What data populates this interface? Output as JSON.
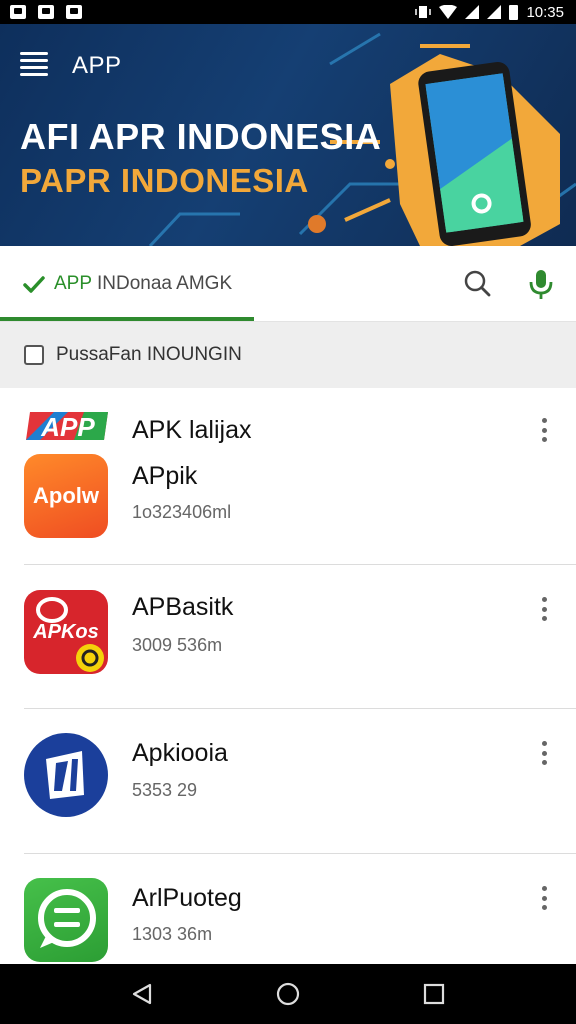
{
  "status_bar": {
    "time": "10:35"
  },
  "header": {
    "app_title": "APP",
    "hero_title_line1": "AFI APR INDONESIA",
    "hero_title_line2": "PAPR INDONESIA"
  },
  "search": {
    "query_prefix": "APP",
    "query_rest": " INDonaa AMGK"
  },
  "filter": {
    "label": "PussaFan  INOUNGIN",
    "checked": false
  },
  "apps": [
    {
      "name": "APK lalijax",
      "banner_text": "APP",
      "icon_text": "Apolw",
      "subtitle": "APpik",
      "size": "1o323406ml"
    },
    {
      "name": "APBasitk",
      "icon_text": "APKos",
      "size": "3009 536m"
    },
    {
      "name": "Apkiooia",
      "size": "5353 29"
    },
    {
      "name": "ArlPuoteg",
      "size": "1303 36m"
    }
  ],
  "colors": {
    "accent_green": "#2f8a2f",
    "hero_orange": "#f2a83a",
    "hero_blue": "#0e2f5c"
  }
}
